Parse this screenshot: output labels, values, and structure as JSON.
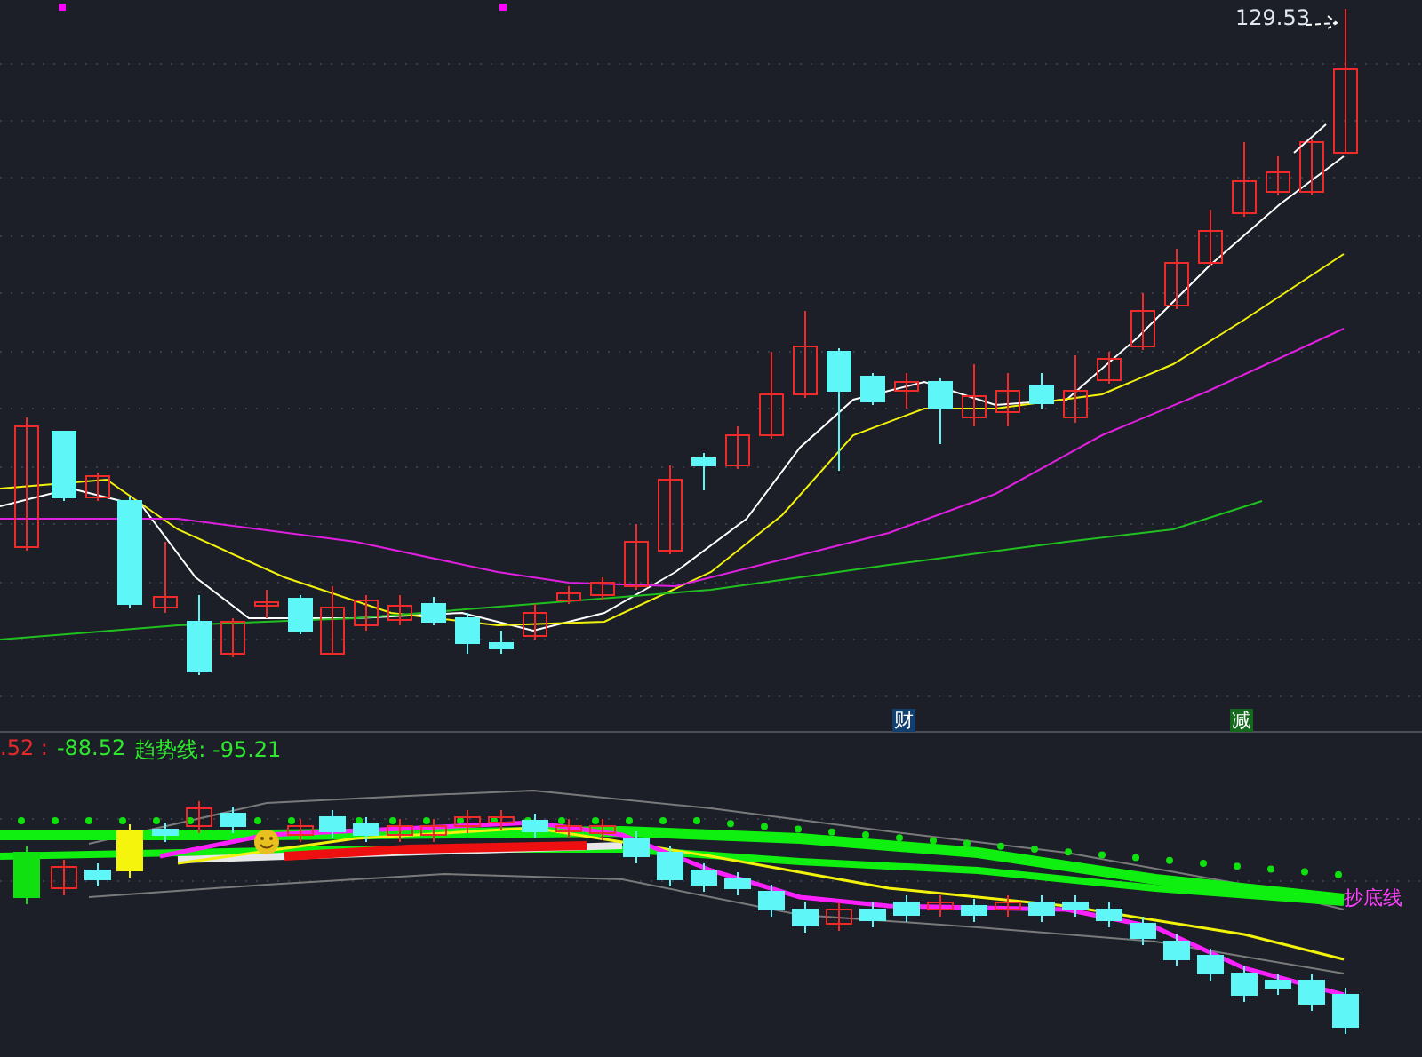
{
  "main_chart": {
    "high_label": "129.53",
    "event_markers": [
      {
        "label": "财",
        "color": "#123f6e"
      },
      {
        "label": "减",
        "color": "#146a1c"
      }
    ]
  },
  "indicator": {
    "readings": [
      {
        "text": ".52 :",
        "color": "#e8282a"
      },
      {
        "text": "-88.52",
        "color": "#2ee82e"
      },
      {
        "text": "趋势线: -95.21",
        "color": "#2ee82e"
      }
    ],
    "line_label": "抄底线"
  }
}
